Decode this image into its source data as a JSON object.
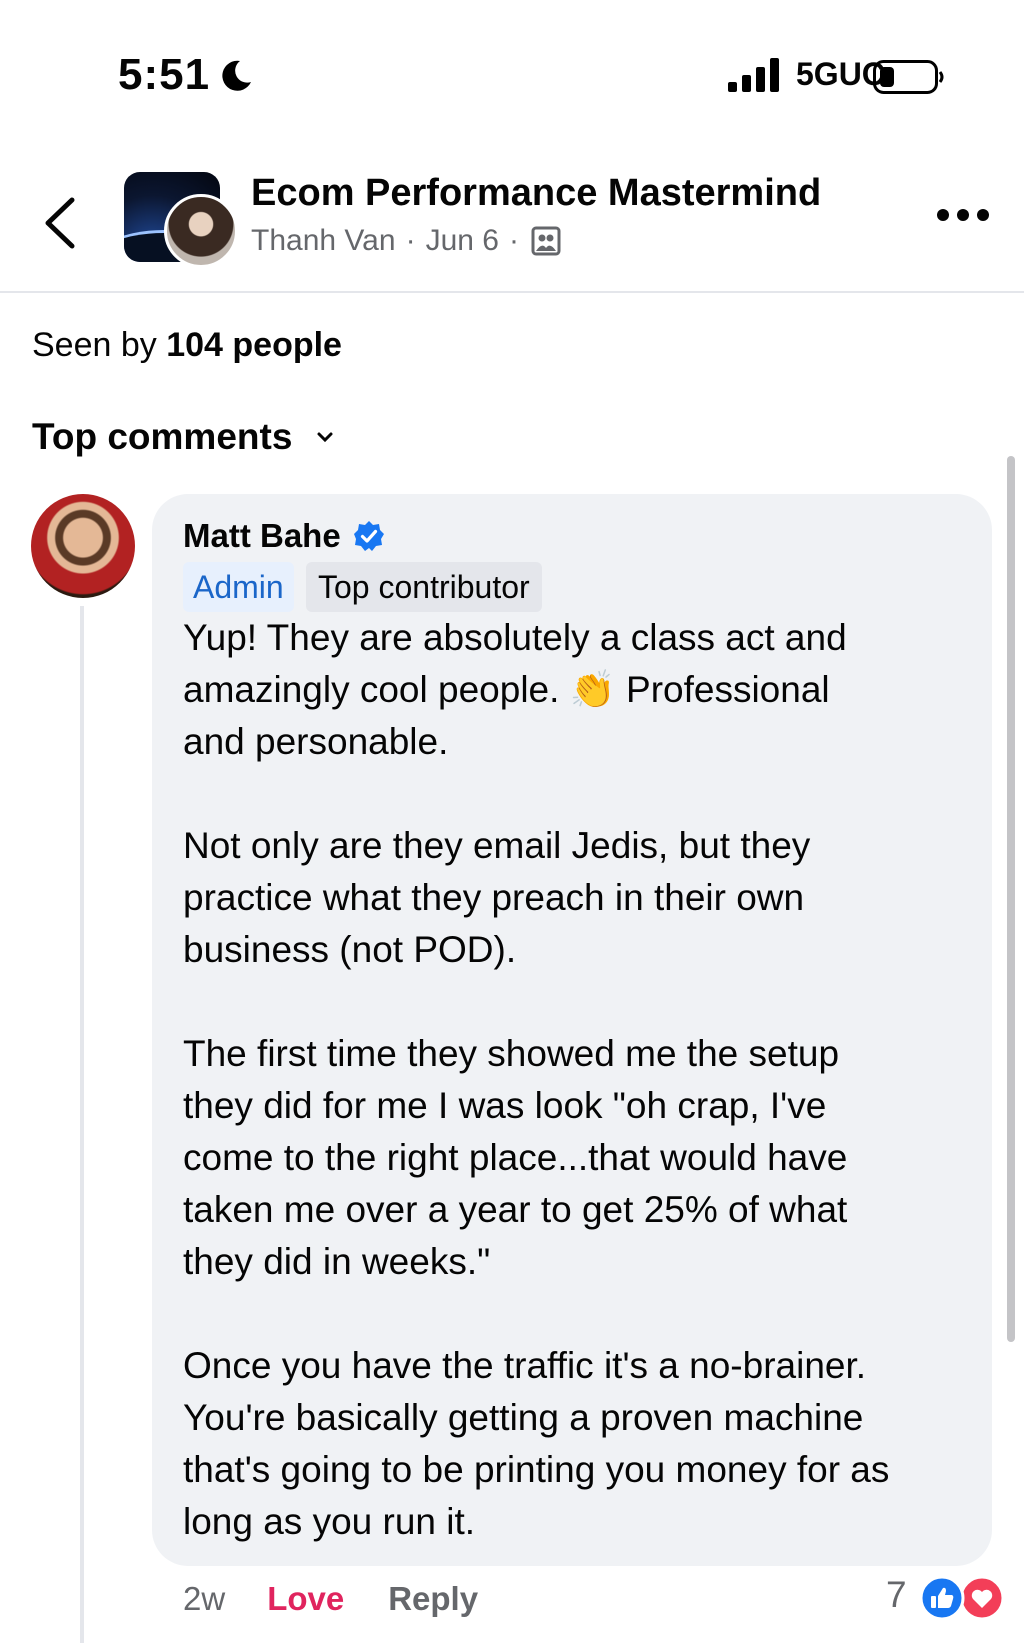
{
  "status_bar": {
    "time": "5:51",
    "network": "5GUC"
  },
  "header": {
    "group_name": "Ecom Performance Mastermind",
    "poster": "Thanh Van",
    "date": "Jun 6",
    "separator": "·"
  },
  "seen_by": {
    "prefix": "Seen by",
    "count_label": "104 people"
  },
  "comments_section": {
    "sort_label": "Top comments"
  },
  "comment": {
    "author": "Matt Bahe",
    "badges": [
      "Admin",
      "Top contributor"
    ],
    "paragraphs": [
      "Yup! They are absolutely a class act and\namazingly cool people. 👏 Professional\nand personable.",
      "Not only are they email Jedis, but they\npractice what they preach in their own\nbusiness (not POD).",
      "The first time they showed me the setup\nthey did for me I was look \"oh crap, I've\ncome to the right place...that would have\ntaken me over a year to get 25% of what\nthey did in weeks.\"",
      "Once you have the traffic it's a no-brainer.\nYou're basically getting a proven machine\nthat's going to be printing you money for as\nlong as you run it."
    ],
    "time_ago": "2w",
    "reaction_label": "Love",
    "reply_label": "Reply",
    "reaction_count": "7"
  },
  "icons": [
    "moon-icon",
    "signal-icon",
    "battery-icon",
    "back-icon",
    "group-icon",
    "more-icon",
    "chevron-down-icon",
    "verified-icon",
    "like-reaction-icon",
    "love-reaction-icon"
  ],
  "colors": {
    "verified": "#1877f2",
    "love": "#e0245e",
    "admin_badge_text": "#1b66c9",
    "bubble": "#f0f2f5"
  }
}
